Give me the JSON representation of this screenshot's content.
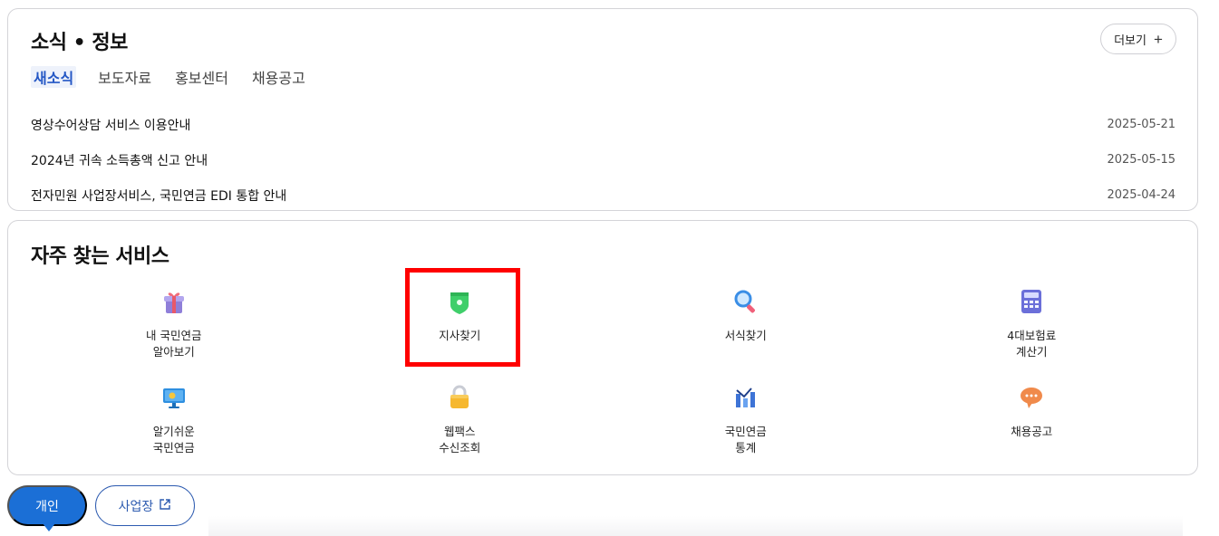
{
  "news": {
    "title": "소식 • 정보",
    "more_label": "더보기",
    "tabs": [
      {
        "label": "새소식"
      },
      {
        "label": "보도자료"
      },
      {
        "label": "홍보센터"
      },
      {
        "label": "채용공고"
      }
    ],
    "items": [
      {
        "title": "영상수어상담 서비스 이용안내",
        "date": "2025-05-21"
      },
      {
        "title": "2024년 귀속 소득총액 신고 안내",
        "date": "2025-05-15"
      },
      {
        "title": "전자민원 사업장서비스, 국민연금 EDI 통합 안내",
        "date": "2025-04-24"
      }
    ]
  },
  "services": {
    "title": "자주 찾는 서비스",
    "items": [
      {
        "label": "내 국민연금\n알아보기",
        "icon": "gift-icon"
      },
      {
        "label": "지사찾기",
        "icon": "map-pin-icon"
      },
      {
        "label": "서식찾기",
        "icon": "magnifier-icon"
      },
      {
        "label": "4대보험료\n계산기",
        "icon": "calculator-icon"
      },
      {
        "label": "알기쉬운\n국민연금",
        "icon": "monitor-icon"
      },
      {
        "label": "웹팩스\n수신조회",
        "icon": "lock-icon"
      },
      {
        "label": "국민연금\n통계",
        "icon": "chart-icon"
      },
      {
        "label": "채용공고",
        "icon": "speech-bubble-icon"
      }
    ]
  },
  "bottom_tabs": {
    "personal": "개인",
    "business": "사업장"
  },
  "colors": {
    "accent": "#1b6fd6",
    "active_tab": "#2457c5",
    "highlight": "#ff0000"
  }
}
